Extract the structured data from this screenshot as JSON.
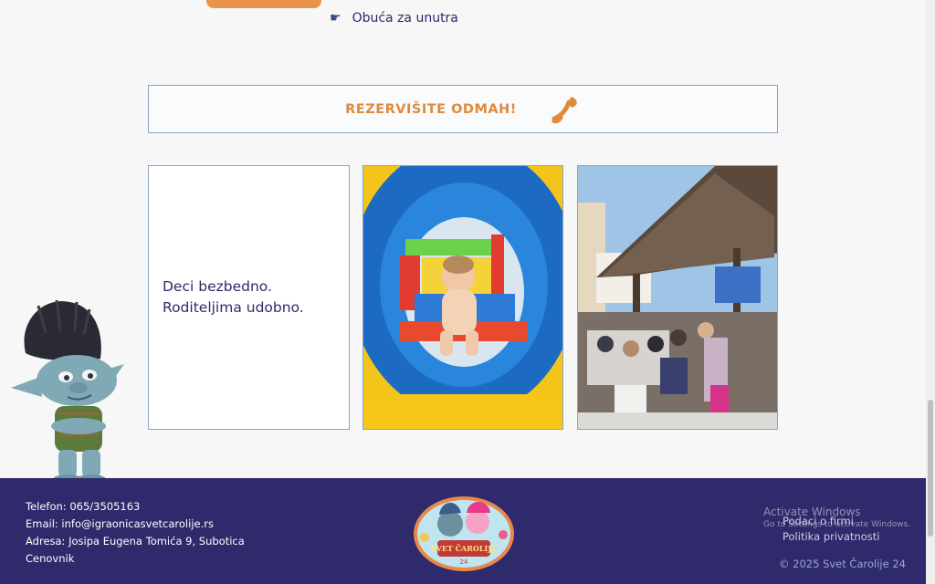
{
  "list": {
    "item": "Obuća za unutra",
    "icon": "pointing-hand-icon"
  },
  "cta": {
    "label": "REZERVIŠITE  ODMAH!",
    "icon": "phone-icon"
  },
  "card": {
    "line1": "Deci bezbedno.",
    "line2": "Roditeljima udobno."
  },
  "footer": {
    "phone": "Telefon: 065/3505163",
    "email": "Email: info@igraonicasvetcarolije.rs",
    "address": "Adresa: Josipa Eugena Tomića 9, Subotica",
    "pricelist": "Cenovnik",
    "company_link": "Podaci o firmi",
    "privacy_link": "Politika privatnosti",
    "copyright": "© 2025 Svet Čarolije 24",
    "logo_text": "SVET ČAROLIJE",
    "logo_num": "24"
  },
  "watermark": {
    "line1": "Activate Windows",
    "line2": "Go to Settings to activate Windows."
  },
  "colors": {
    "primary": "#2e2a6b",
    "accent": "#e08a3c",
    "border": "#8aa4c8"
  }
}
